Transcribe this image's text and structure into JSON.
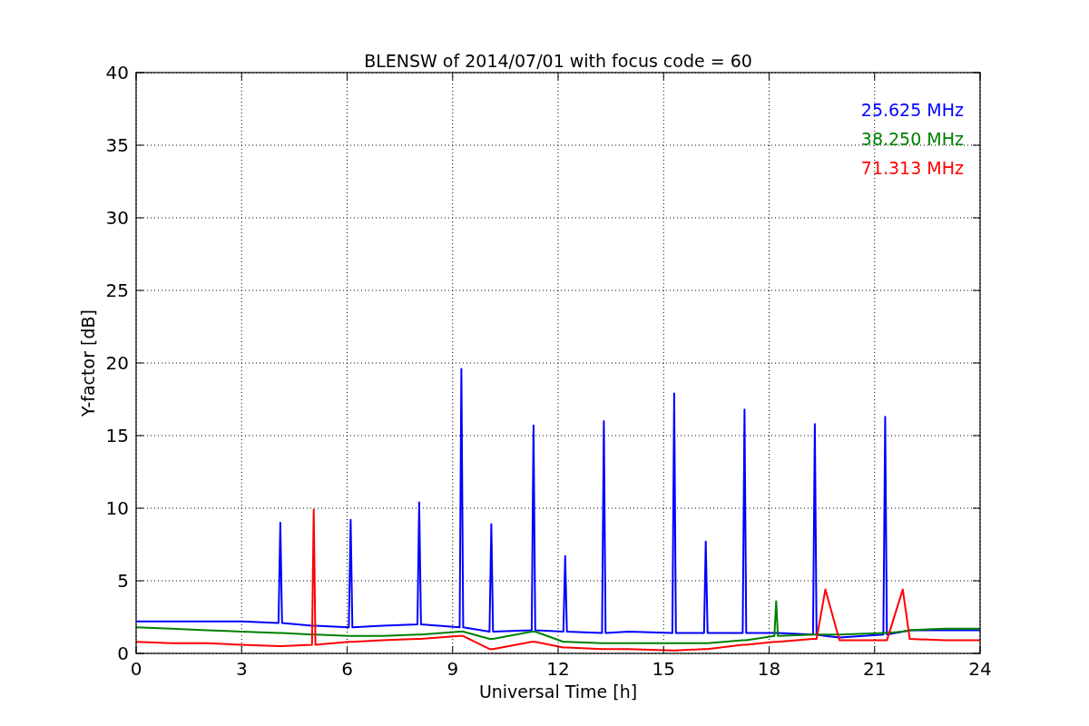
{
  "chart_data": {
    "type": "line",
    "title": "BLENSW of 2014/07/01 with focus code = 60",
    "xlabel": "Universal Time [h]",
    "ylabel": "Y-factor [dB]",
    "x": [
      0,
      1,
      2,
      3,
      4.05,
      4.1,
      4.15,
      5,
      5.05,
      5.1,
      6.05,
      6.1,
      6.15,
      7,
      8,
      8.05,
      8.1,
      9.2,
      9.25,
      9.3,
      10.05,
      10.1,
      10.15,
      11.25,
      11.3,
      11.35,
      12.15,
      12.2,
      12.25,
      13.25,
      13.3,
      13.35,
      14,
      15.25,
      15.3,
      15.35,
      16.15,
      16.2,
      16.25,
      17.25,
      17.3,
      17.35,
      18.15,
      18.2,
      18.25,
      19.25,
      19.3,
      19.35,
      19.6,
      20,
      21.25,
      21.3,
      21.35,
      21.8,
      22,
      23,
      24
    ],
    "series": [
      {
        "name": "25.625 MHz",
        "color": "#0000ff",
        "values": [
          2.2,
          2.2,
          2.2,
          2.2,
          2.1,
          9.0,
          2.1,
          1.9,
          1.9,
          1.9,
          1.8,
          9.2,
          1.8,
          1.9,
          2.0,
          10.4,
          2.0,
          1.8,
          19.6,
          1.8,
          1.5,
          8.9,
          1.5,
          1.6,
          15.7,
          1.6,
          1.5,
          6.7,
          1.5,
          1.4,
          16.0,
          1.4,
          1.5,
          1.4,
          17.9,
          1.4,
          1.4,
          7.7,
          1.4,
          1.4,
          16.8,
          1.4,
          1.4,
          1.4,
          1.4,
          1.3,
          15.8,
          1.3,
          1.2,
          1.1,
          1.3,
          16.3,
          1.3,
          1.5,
          1.6,
          1.6,
          1.6
        ]
      },
      {
        "name": "38.250 MHz",
        "color": "#008000",
        "values": [
          1.8,
          1.7,
          1.6,
          1.5,
          1.4,
          1.4,
          1.4,
          1.3,
          1.3,
          1.3,
          1.2,
          1.2,
          1.2,
          1.2,
          1.3,
          1.3,
          1.3,
          1.5,
          1.5,
          1.5,
          1.0,
          1.0,
          1.0,
          1.5,
          1.5,
          1.5,
          0.8,
          0.8,
          0.8,
          0.7,
          0.7,
          0.7,
          0.7,
          0.7,
          0.7,
          0.7,
          0.7,
          0.7,
          0.7,
          0.9,
          0.9,
          0.9,
          1.2,
          3.6,
          1.2,
          1.3,
          1.3,
          1.3,
          1.3,
          1.3,
          1.4,
          1.4,
          1.4,
          1.5,
          1.6,
          1.7,
          1.7
        ]
      },
      {
        "name": "71.313 MHz",
        "color": "#ff0000",
        "values": [
          0.8,
          0.7,
          0.7,
          0.6,
          0.5,
          0.5,
          0.5,
          0.6,
          9.9,
          0.6,
          0.8,
          0.8,
          0.8,
          0.9,
          1.0,
          1.0,
          1.0,
          1.2,
          1.2,
          1.2,
          0.3,
          0.3,
          0.3,
          0.8,
          0.8,
          0.8,
          0.4,
          0.4,
          0.4,
          0.3,
          0.3,
          0.3,
          0.3,
          0.2,
          0.2,
          0.2,
          0.3,
          0.3,
          0.3,
          0.6,
          0.6,
          0.6,
          0.8,
          0.8,
          0.8,
          1.0,
          1.0,
          1.0,
          4.4,
          0.9,
          0.9,
          0.9,
          0.9,
          4.4,
          1.0,
          0.9,
          0.9
        ]
      }
    ],
    "xlim": [
      0,
      24
    ],
    "ylim": [
      0,
      40
    ],
    "xticks": [
      0,
      3,
      6,
      9,
      12,
      15,
      18,
      21,
      24
    ],
    "yticks": [
      0,
      5,
      10,
      15,
      20,
      25,
      30,
      35,
      40
    ],
    "grid": true
  }
}
